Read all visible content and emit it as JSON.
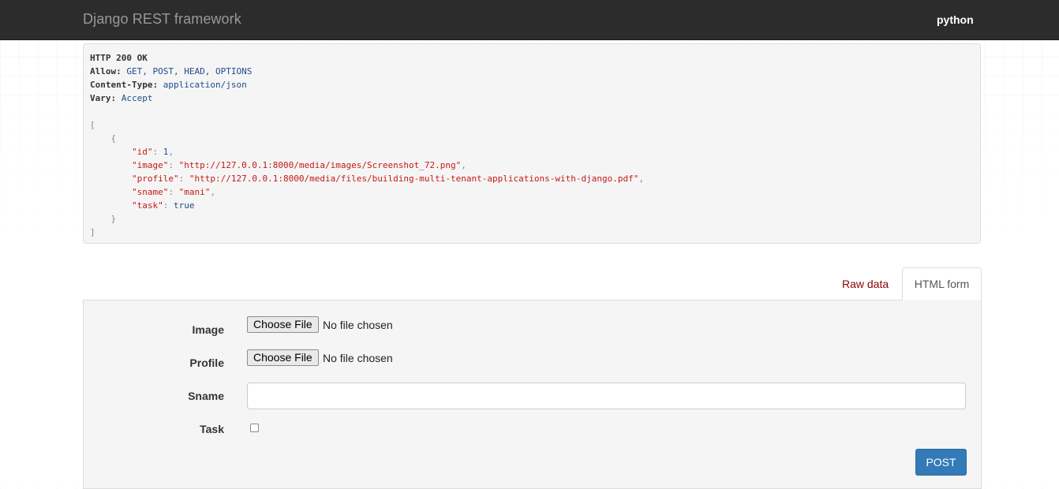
{
  "navbar": {
    "brand": "Django REST framework",
    "user": "python"
  },
  "response": {
    "status": "HTTP 200 OK",
    "headers": [
      {
        "key": "Allow",
        "value": "GET, POST, HEAD, OPTIONS"
      },
      {
        "key": "Content-Type",
        "value": "application/json"
      },
      {
        "key": "Vary",
        "value": "Accept"
      }
    ],
    "body": {
      "open_bracket": "[",
      "open_brace": "{",
      "fields": [
        {
          "key": "\"id\"",
          "value": "1",
          "type": "number",
          "trail": ","
        },
        {
          "key": "\"image\"",
          "value": "\"http://127.0.0.1:8000/media/images/Screenshot_72.png\"",
          "type": "string",
          "trail": ","
        },
        {
          "key": "\"profile\"",
          "value": "\"http://127.0.0.1:8000/media/files/building-multi-tenant-applications-with-django.pdf\"",
          "type": "string",
          "trail": ","
        },
        {
          "key": "\"sname\"",
          "value": "\"mani\"",
          "type": "string",
          "trail": ","
        },
        {
          "key": "\"task\"",
          "value": "true",
          "type": "number",
          "trail": ""
        }
      ],
      "close_brace": "}",
      "close_bracket": "]"
    }
  },
  "tabs": {
    "raw": "Raw data",
    "html": "HTML form"
  },
  "form": {
    "image_label": "Image",
    "profile_label": "Profile",
    "sname_label": "Sname",
    "task_label": "Task",
    "choose_file": "Choose File",
    "no_file": "No file chosen",
    "sname_value": "",
    "task_checked": false,
    "submit": "POST"
  },
  "colors": {
    "navbar": "#2c2c2c",
    "primary": "#337ab7",
    "tab_link": "#8b0000",
    "json_string": "#c41a16",
    "json_value": "#1f4b8a"
  }
}
